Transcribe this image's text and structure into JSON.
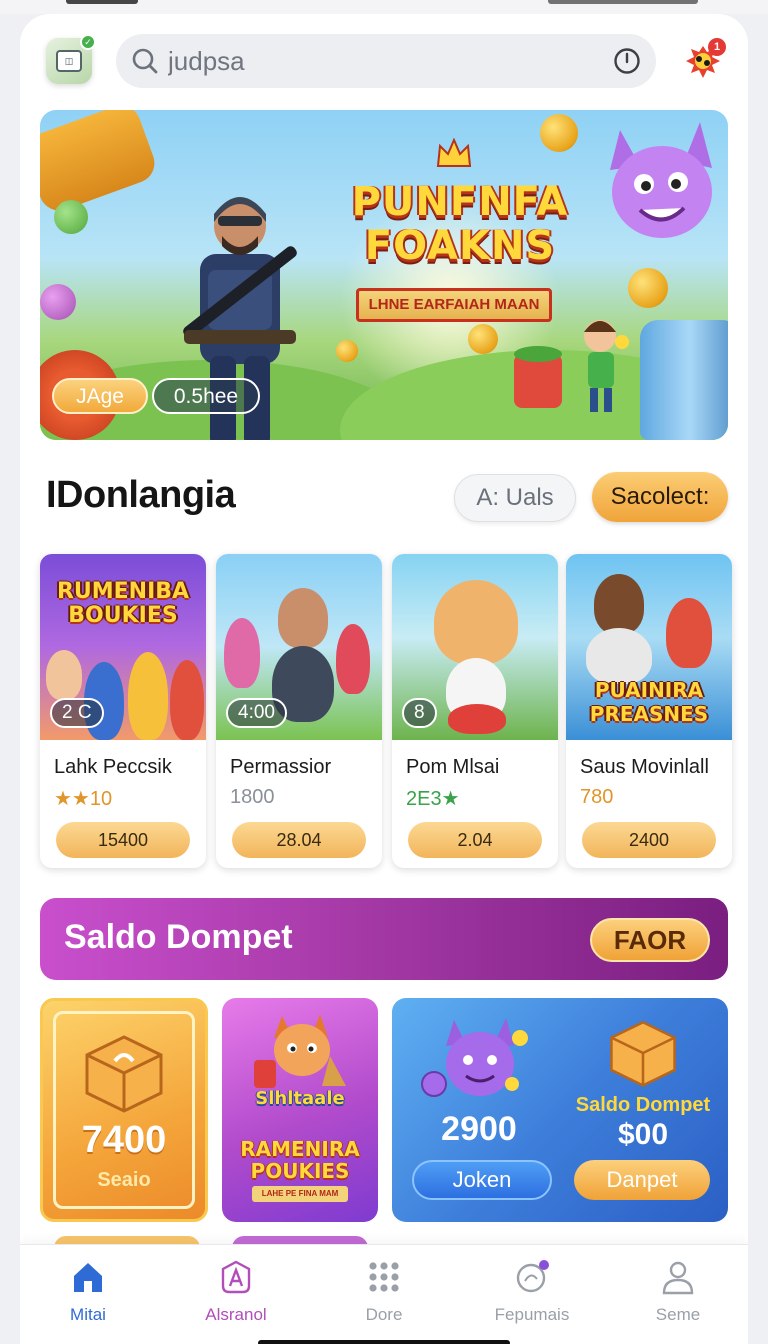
{
  "search": {
    "value": "judpsa"
  },
  "notifications": {
    "count": "1"
  },
  "hero": {
    "title_line1": "PUNFNFA",
    "title_line2": "FOAKNS",
    "ribbon": "LHNE EARFAIAH MAAN",
    "chip_age": "JAge",
    "chip_time": "0.5hee"
  },
  "section": {
    "title": "IDonlangia",
    "all_button": "A: Uals",
    "select_button": "Sacolect:"
  },
  "games": [
    {
      "thumb_title": "RUMENIBA BOUKIES",
      "badge": "2 C",
      "name": "Lahk Peccsik",
      "sub": "★★10",
      "sub_color": "#9aa0a8",
      "price": "15400"
    },
    {
      "thumb_title": "",
      "badge": "4:00",
      "name": "Permassior",
      "sub": "1800",
      "sub_color": "#8a9098",
      "price": "28.04"
    },
    {
      "thumb_title": "",
      "badge": "8",
      "name": "Pom Mlsai",
      "sub": "2E3★",
      "sub_color": "#3aa34a",
      "price": "2.04"
    },
    {
      "thumb_title": "PUAINIRA PREASNES",
      "badge": "",
      "name": "Saus Movinlall",
      "sub": "780",
      "sub_color": "#e0962a",
      "price": "2400"
    }
  ],
  "wallet": {
    "title": "Saldo Dompet",
    "badge": "FAOR",
    "tile1_value": "7400",
    "tile1_label": "Seaio",
    "tile2_text1": "Slhltaale",
    "tile2_text2": "RAMENIRA POUKIES",
    "tile2_text3": "LAHE PE FINA MAM",
    "tile3_value1": "2900",
    "tile3_button1": "Joken",
    "tile3_label2": "Saldo Dompet",
    "tile3_value2": "$00",
    "tile3_button2": "Danpet"
  },
  "nav": [
    {
      "label": "Mitai",
      "icon": "home-icon",
      "active": true
    },
    {
      "label": "Alsranol",
      "icon": "shield-a-icon",
      "active": false
    },
    {
      "label": "Dore",
      "icon": "grid-icon",
      "active": false
    },
    {
      "label": "Fepumais",
      "icon": "chat-icon",
      "active": false
    },
    {
      "label": "Seme",
      "icon": "user-icon",
      "active": false
    }
  ],
  "colors": {
    "accent_orange": "#f0a43a",
    "accent_purple": "#a63aa7",
    "nav_active": "#2f6bd4",
    "nav_secondary": "#b04fb9"
  }
}
